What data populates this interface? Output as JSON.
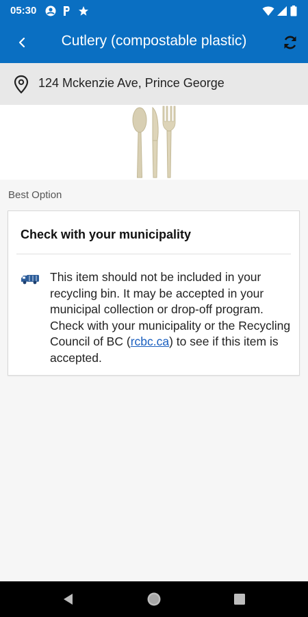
{
  "status_bar": {
    "time": "05:30",
    "icons": [
      "account-circle-icon",
      "parking-icon",
      "star-icon",
      "wifi-icon",
      "signal-icon",
      "battery-icon"
    ]
  },
  "app_bar": {
    "title": "Cutlery (compostable plastic)",
    "back_icon": "chevron-left-icon",
    "refresh_icon": "refresh-icon"
  },
  "location": {
    "icon": "location-pin-icon",
    "address": "124 Mckenzie Ave, Prince George"
  },
  "hero_image": {
    "subject": "cutlery-image"
  },
  "best_option": {
    "section_label": "Best Option",
    "card_title": "Check with your municipality",
    "icon": "truck-icon",
    "body_text_before_link": "This item should not be included in your recycling bin. It may be accepted in your municipal collection or drop-off program. Check with your municipality or the Recycling Council of BC (",
    "link_text": "rcbc.ca",
    "body_text_after_link": ") to see if this item is accepted."
  },
  "nav_bar": {
    "icons": [
      "nav-back-icon",
      "nav-home-icon",
      "nav-recents-icon"
    ]
  },
  "colors": {
    "app_bar": "#0a6fc2",
    "link": "#1a5fbf",
    "truck": "#2d5d9a"
  }
}
